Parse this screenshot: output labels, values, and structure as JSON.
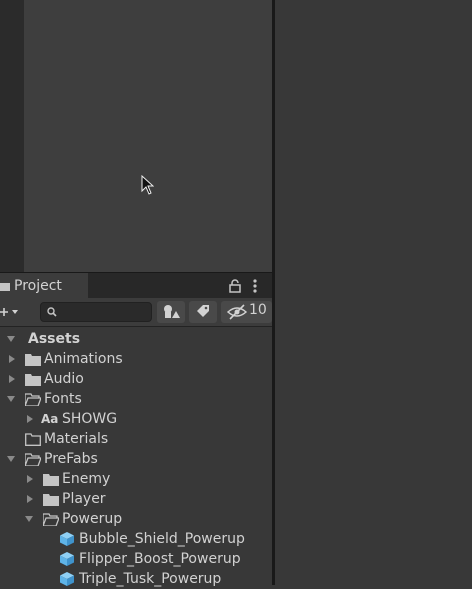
{
  "project_window": {
    "tab_label": "Project",
    "hidden_count": "10",
    "search_placeholder": ""
  },
  "tree": {
    "assets": "Assets",
    "animations": "Animations",
    "audio": "Audio",
    "fonts": "Fonts",
    "font_showg_prefix": "Aa",
    "font_showg": "SHOWG",
    "materials": "Materials",
    "prefabs": "PreFabs",
    "enemy": "Enemy",
    "player": "Player",
    "powerup": "Powerup",
    "items": [
      "Bubble_Shield_Powerup",
      "Flipper_Boost_Powerup",
      "Triple_Tusk_Powerup"
    ]
  },
  "colors": {
    "background": "#383838",
    "scene": "#3e3e3e",
    "prefab_blue": "#5fb4e8"
  }
}
